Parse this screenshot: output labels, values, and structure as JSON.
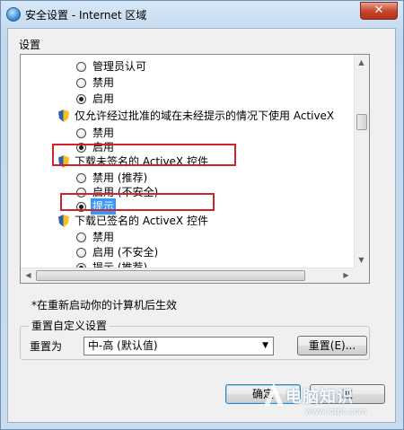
{
  "window": {
    "title": "安全设置 - Internet 区域",
    "close_glyph": "✕"
  },
  "settings": {
    "group_label": "设置",
    "items": [
      {
        "type": "radio",
        "label": "管理员认可",
        "checked": false
      },
      {
        "type": "radio",
        "label": "禁用",
        "checked": false
      },
      {
        "type": "radio",
        "label": "启用",
        "checked": true
      },
      {
        "type": "header",
        "label": "仅允许经过批准的域在未经提示的情况下使用 ActiveX"
      },
      {
        "type": "radio",
        "label": "禁用",
        "checked": false
      },
      {
        "type": "radio",
        "label": "启用",
        "checked": true
      },
      {
        "type": "header",
        "label": "下载未签名的 ActiveX 控件"
      },
      {
        "type": "radio",
        "label": "禁用 (推荐)",
        "checked": false
      },
      {
        "type": "radio",
        "label": "启用 (不安全)",
        "checked": false
      },
      {
        "type": "radio",
        "label": "提示",
        "checked": true,
        "selected": true
      },
      {
        "type": "header",
        "label": "下载已签名的 ActiveX 控件"
      },
      {
        "type": "radio",
        "label": "禁用",
        "checked": false
      },
      {
        "type": "radio",
        "label": "启用 (不安全)",
        "checked": false
      },
      {
        "type": "radio",
        "label": "提示 (推荐)",
        "checked": true
      }
    ]
  },
  "note": "*在重新启动你的计算机后生效",
  "reset": {
    "group_label": "重置自定义设置",
    "label": "重置为",
    "selected": "中-高 (默认值)",
    "button": "重置(E)..."
  },
  "buttons": {
    "ok": "确定",
    "cancel": "取"
  },
  "watermark": {
    "text": "电脑知识",
    "url": "www.lotpc.com"
  },
  "colors": {
    "highlight": "#3399ff",
    "annotation": "#d0232a"
  }
}
